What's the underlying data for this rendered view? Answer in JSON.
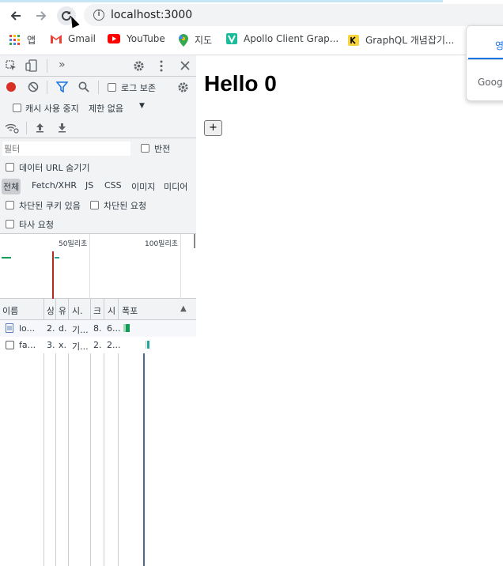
{
  "browser": {
    "url": "localhost:3000",
    "bookmarks": [
      {
        "label": "앱",
        "icon": "apps-grid-icon"
      },
      {
        "label": "Gmail",
        "icon": "gmail-icon"
      },
      {
        "label": "YouTube",
        "icon": "youtube-icon"
      },
      {
        "label": "지도",
        "icon": "maps-pin-icon"
      },
      {
        "label": "Apollo Client Grap...",
        "icon": "apollo-v-icon"
      },
      {
        "label": "GraphQL 개념잡기...",
        "icon": "k-icon"
      }
    ],
    "popup": {
      "tab_label": "영",
      "text": "Goog"
    }
  },
  "devtools": {
    "more_tabs": "»",
    "preserve_log": "로그 보존",
    "disable_cache": "캐시 사용 중지",
    "throttle": "제한 없음",
    "filter_placeholder": "필터",
    "invert": "반전",
    "hide_data_urls": "데이터 URL 숨기기",
    "type_filters": [
      "전체",
      "Fetch/XHR",
      "JS",
      "CSS",
      "이미지",
      "미디어"
    ],
    "blocked_cookies": "차단된 쿠키 있음",
    "blocked_requests": "차단된 요청",
    "third_party": "타사 요청",
    "timeline": {
      "tick1": "50밀리초",
      "tick2": "100밀리초"
    },
    "table": {
      "headers": [
        "이름",
        "상",
        "유",
        "시.",
        "크",
        "시",
        "폭포"
      ],
      "sort_icon": "▲",
      "rows": [
        {
          "name": "lo...",
          "c1": "2.",
          "c2": "d.",
          "c3": "기...",
          "c4": "8.",
          "c5": "6..."
        },
        {
          "name": "fa...",
          "c1": "3.",
          "c2": "x.",
          "c3": "기...",
          "c4": "2.",
          "c5": "2..."
        }
      ]
    }
  },
  "page": {
    "title": "Hello 0",
    "button": "+"
  },
  "colors": {
    "accent": "#1a73e8",
    "record": "#d93025",
    "waterfall_green": "#0f9d58",
    "youtube": "#ff0000"
  }
}
